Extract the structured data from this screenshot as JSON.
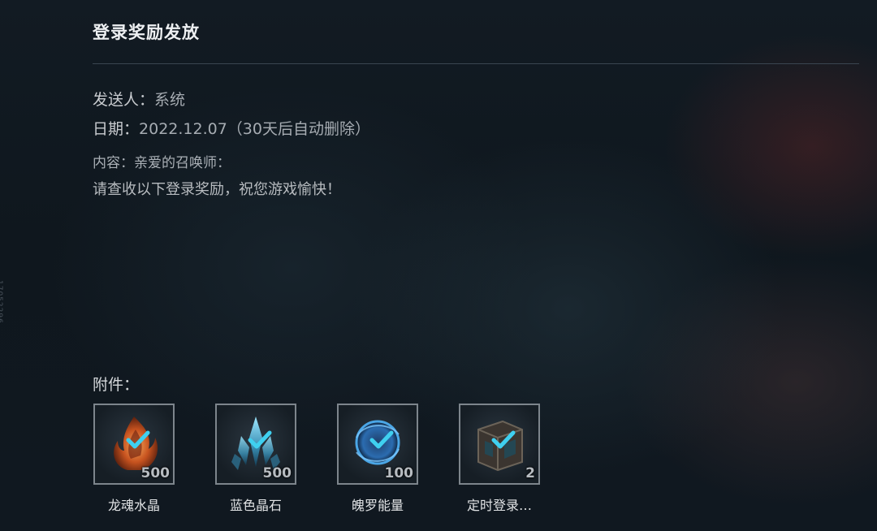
{
  "side_mark": "17052296",
  "title": "登录奖励发放",
  "sender": {
    "label": "发送人：",
    "value": "系统"
  },
  "date": {
    "label": "日期：",
    "value": "2022.12.07（30天后自动删除）"
  },
  "content": {
    "label": "内容：",
    "greeting": "亲爱的召唤师：",
    "body": "请查收以下登录奖励，祝您游戏愉快！"
  },
  "attachments": {
    "label": "附件：",
    "items": [
      {
        "name": "龙魂水晶",
        "qty": "500",
        "icon": "dragon-soul-crystal-icon",
        "claimed": true
      },
      {
        "name": "蓝色晶石",
        "qty": "500",
        "icon": "blue-essence-icon",
        "claimed": true
      },
      {
        "name": "魄罗能量",
        "qty": "100",
        "icon": "poro-energy-icon",
        "claimed": true
      },
      {
        "name": "定时登录…",
        "qty": "2",
        "icon": "timed-login-chest-icon",
        "claimed": true
      }
    ]
  },
  "colors": {
    "check": "#3fd0f0",
    "border": "#7d858c"
  }
}
